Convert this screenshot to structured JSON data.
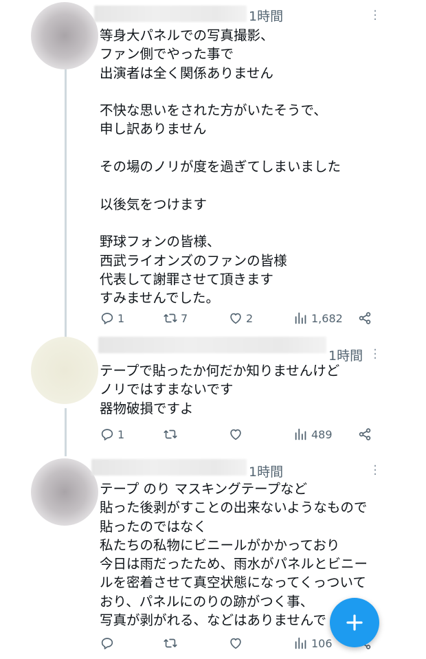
{
  "tweets": [
    {
      "time": "1時間",
      "lines": [
        "等身大パネルでの写真撮影、",
        "ファン側でやった事で",
        "出演者は全く関係ありません",
        "",
        "不快な思いをされた方がいたそうで、",
        "申し訳ありません",
        "",
        "その場のノリが度を過ぎてしまいました",
        "",
        "以後気をつけます",
        "",
        "野球フォンの皆様、",
        "西武ライオンズのファンの皆様",
        "代表して謝罪させて頂きます",
        "すみませんでした。"
      ],
      "replies": "1",
      "retweets": "7",
      "likes": "2",
      "views": "1,682"
    },
    {
      "time": "1時間",
      "lines": [
        "テープで貼ったか何だか知りませんけど",
        "ノリではすまないです",
        "器物破損ですよ"
      ],
      "replies": "1",
      "retweets": "",
      "likes": "",
      "views": "489"
    },
    {
      "time": "1時間",
      "lines": [
        "テープ のり マスキングテープなど",
        "貼った後剥がすことの出来ないようなもので",
        "貼ったのではなく",
        "私たちの私物にビニールがかかっており",
        "今日は雨だったため、雨水がパネルとビニー",
        "ルを密着させて真空状態になってくっついて",
        "おり、パネルにのりの跡がつく事、",
        "写真が剥がれる、などはありませんで"
      ],
      "replies": "",
      "retweets": "",
      "likes": "",
      "views": "106"
    }
  ],
  "icons": {
    "reply": "reply-icon",
    "retweet": "retweet-icon",
    "like": "heart-icon",
    "views": "views-icon",
    "share": "share-icon",
    "more": "more-icon",
    "compose": "compose-plus-icon"
  },
  "colors": {
    "accent": "#1d9bf0",
    "muted_text": "#536471",
    "thread_line": "#cfd9de"
  }
}
